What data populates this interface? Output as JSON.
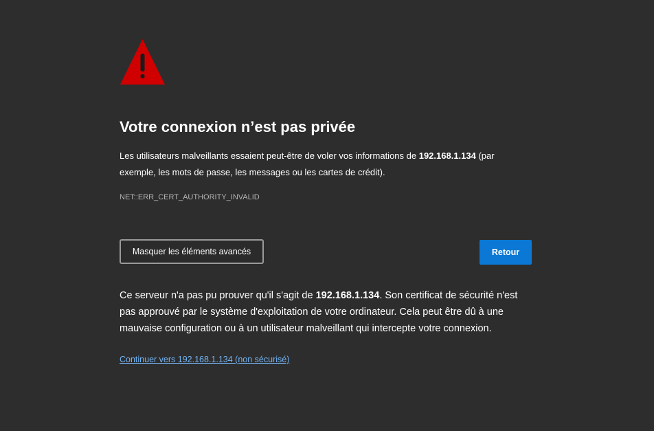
{
  "icon": "warning-triangle-icon",
  "colors": {
    "background": "#2d2d2d",
    "warning_red": "#d10000",
    "primary_button": "#0a78d4",
    "link": "#74b3f2"
  },
  "title": "Votre connexion n’est pas privée",
  "intro": {
    "before": "Les utilisateurs malveillants essaient peut-être de voler vos informations de ",
    "host": "192.168.1.134",
    "after": " (par exemple, les mots de passe, les messages ou les cartes de crédit)."
  },
  "error_code": "NET::ERR_CERT_AUTHORITY_INVALID",
  "buttons": {
    "advanced_label": "Masquer les éléments avancés",
    "back_label": "Retour"
  },
  "details": {
    "before": "Ce serveur n'a pas pu prouver qu'il s'agit de ",
    "host": "192.168.1.134",
    "after": ". Son certificat de sécurité n'est pas approuvé par le système d'exploitation de votre ordinateur. Cela peut être dû à une mauvaise configuration ou à un utilisateur malveillant qui intercepte votre connexion."
  },
  "proceed_link": "Continuer vers 192.168.1.134 (non sécurisé)"
}
